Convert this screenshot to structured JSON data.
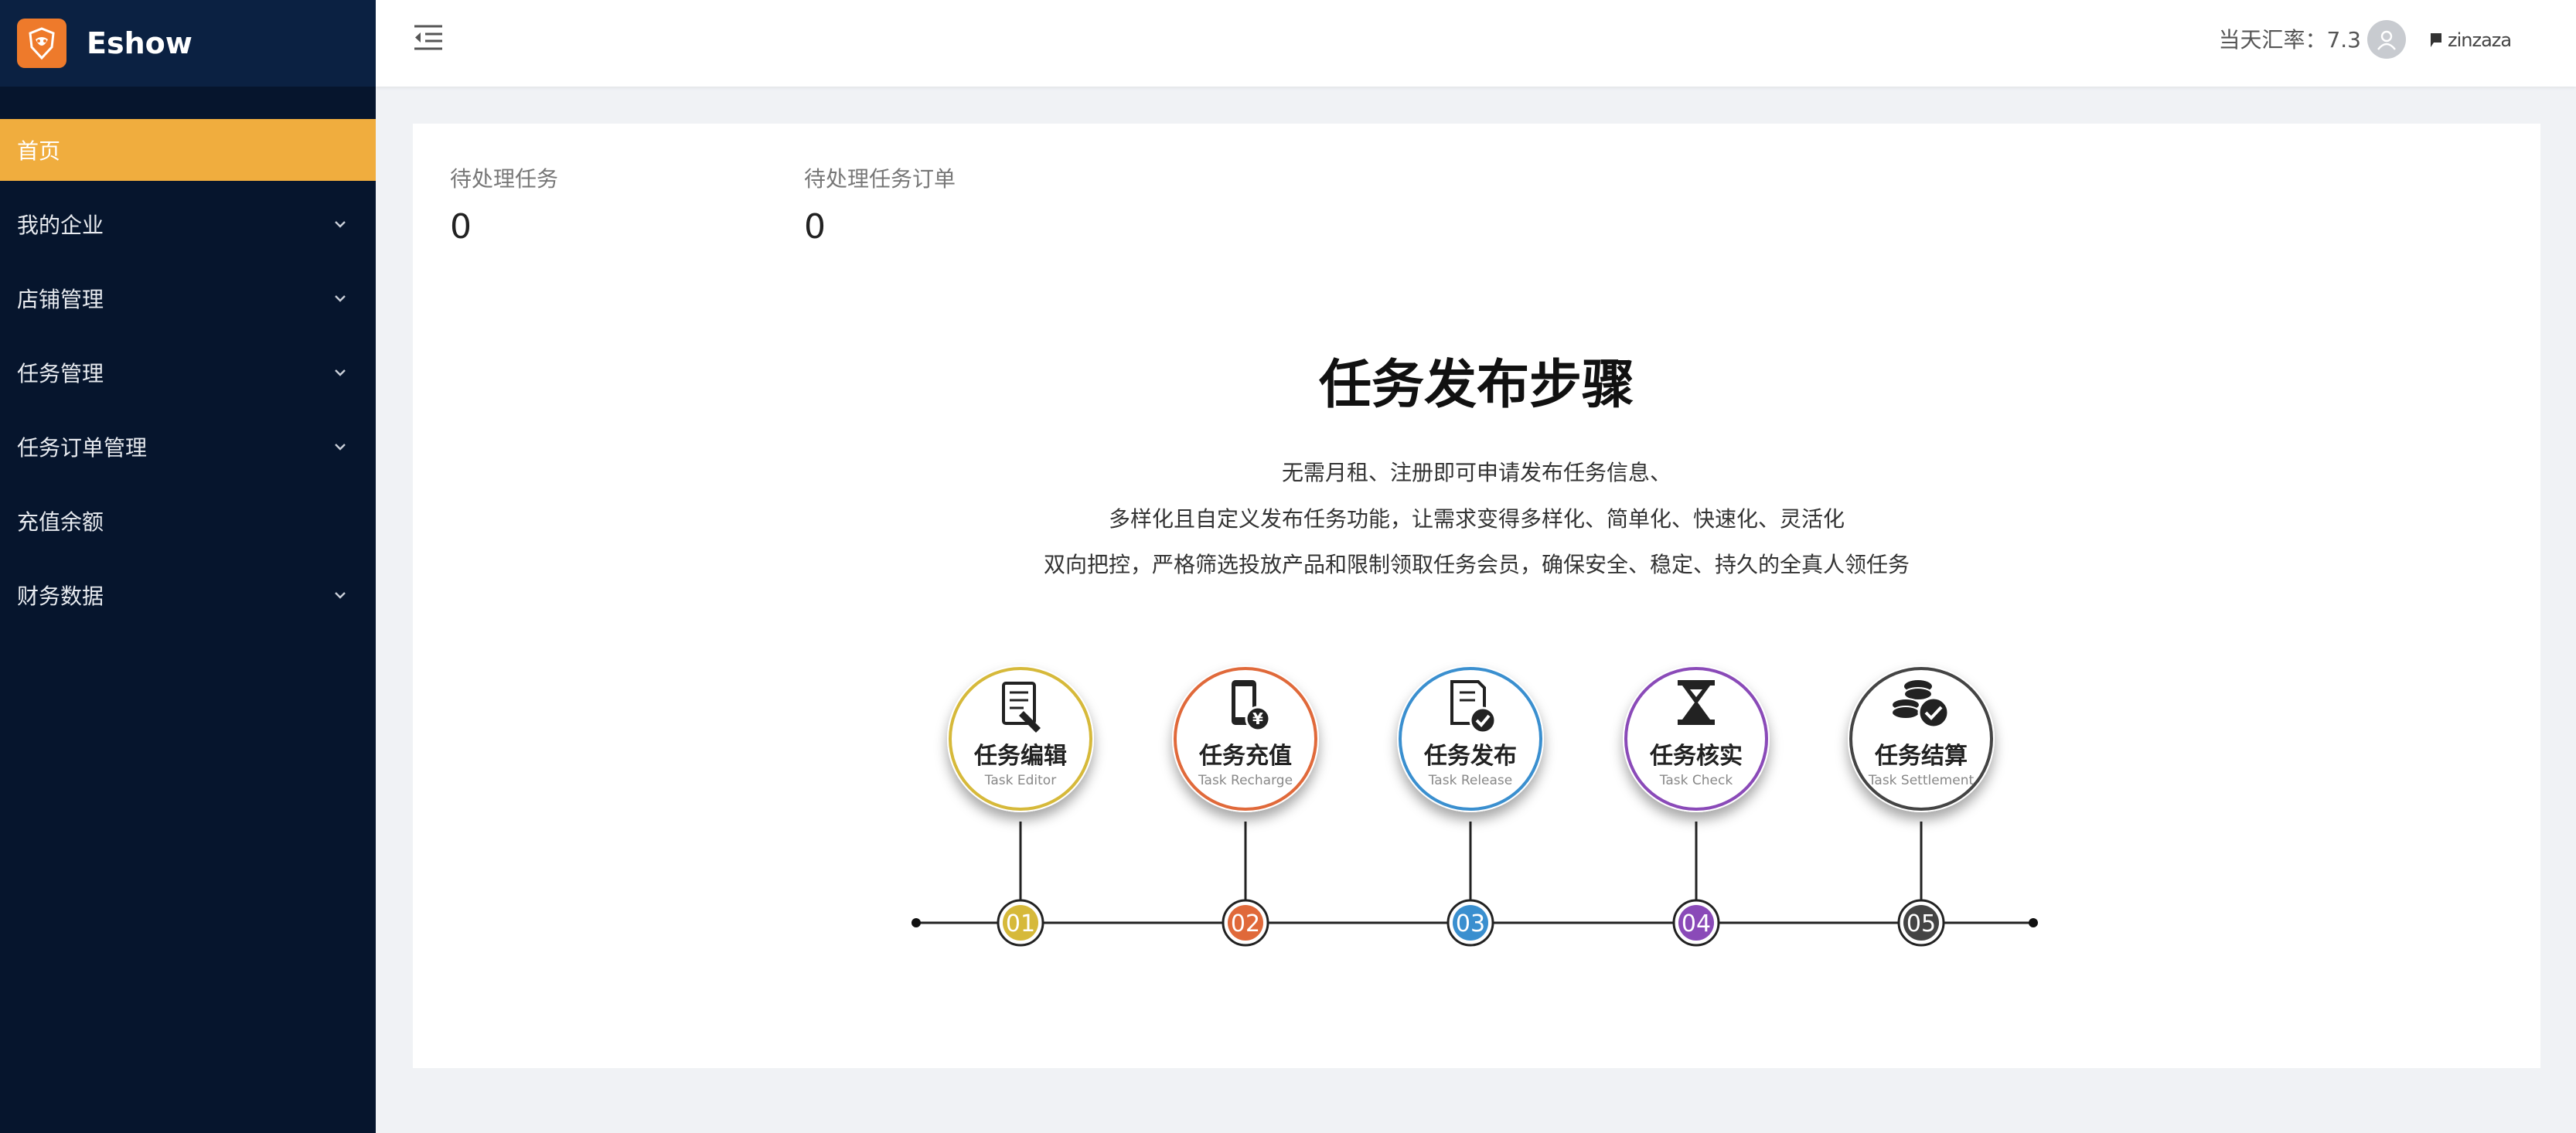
{
  "brand": {
    "name": "Eshow"
  },
  "sidebar": {
    "items": [
      {
        "label": "首页",
        "active": true,
        "has_children": false
      },
      {
        "label": "我的企业",
        "active": false,
        "has_children": true
      },
      {
        "label": "店铺管理",
        "active": false,
        "has_children": true
      },
      {
        "label": "任务管理",
        "active": false,
        "has_children": true
      },
      {
        "label": "任务订单管理",
        "active": false,
        "has_children": true
      },
      {
        "label": "充值余额",
        "active": false,
        "has_children": false
      },
      {
        "label": "财务数据",
        "active": false,
        "has_children": true
      }
    ]
  },
  "header": {
    "exchange_rate": "当天汇率：7.3",
    "username": "zinzaza"
  },
  "stats": [
    {
      "label": "待处理任务",
      "value": "0"
    },
    {
      "label": "待处理任务订单",
      "value": "0"
    }
  ],
  "steps_section": {
    "title": "任务发布步骤",
    "description": [
      "无需月租、注册即可申请发布任务信息、",
      "多样化且自定义发布任务功能，让需求变得多样化、简单化、快速化、灵活化",
      "双向把控，严格筛选投放产品和限制领取任务会员，确保安全、稳定、持久的全真人领任务"
    ],
    "steps": [
      {
        "title": "任务编辑",
        "subtitle": "Task Editor",
        "number": "01",
        "color": "#d6b93a",
        "icon": "document-edit-icon"
      },
      {
        "title": "任务充值",
        "subtitle": "Task Recharge",
        "number": "02",
        "color": "#e0693a",
        "icon": "phone-yuan-icon"
      },
      {
        "title": "任务发布",
        "subtitle": "Task Release",
        "number": "03",
        "color": "#3a8fcf",
        "icon": "document-check-icon"
      },
      {
        "title": "任务核实",
        "subtitle": "Task Check",
        "number": "04",
        "color": "#8a4ab8",
        "icon": "hourglass-icon"
      },
      {
        "title": "任务结算",
        "subtitle": "Task Settlement",
        "number": "05",
        "color": "#444444",
        "icon": "coins-check-icon"
      }
    ]
  },
  "colors": {
    "sidebar_bg": "#06152d",
    "active_menu": "#f0ad3e",
    "brand_bg": "#0b2142"
  }
}
